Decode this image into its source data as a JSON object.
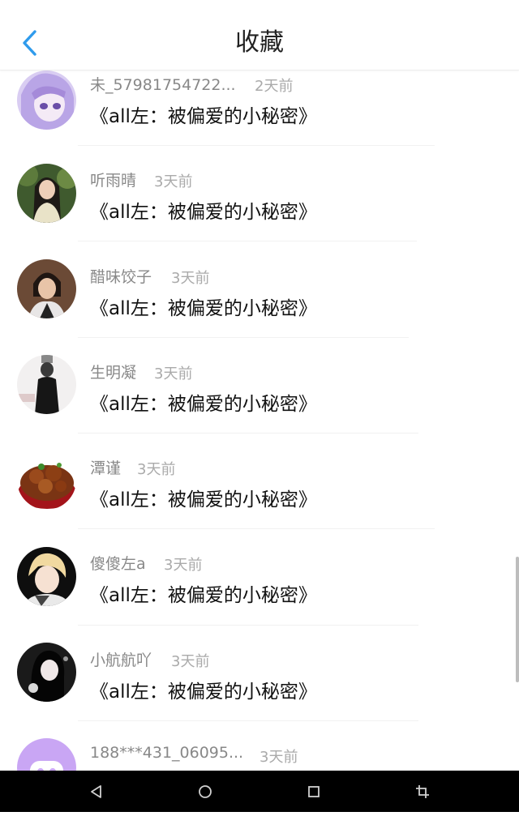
{
  "header": {
    "title": "收藏",
    "back_icon": "chevron-left-icon",
    "accent": "#2f9bec"
  },
  "items": [
    {
      "name": "未_57981754722...",
      "time": "2天前",
      "content": "《all左：被偏爱的小秘密》",
      "avatar": "lavender-anime-avatar"
    },
    {
      "name": "听雨晴",
      "time": "3天前",
      "content": "《all左：被偏爱的小秘密》",
      "avatar": "girl-outdoor-avatar"
    },
    {
      "name": "醋味饺子",
      "time": "3天前",
      "content": "《all左：被偏爱的小秘密》",
      "avatar": "person-portrait-avatar"
    },
    {
      "name": "生明凝",
      "time": "3天前",
      "content": "《all左：被偏爱的小秘密》",
      "avatar": "dark-figure-avatar"
    },
    {
      "name": "潭谨",
      "time": "3天前",
      "content": "《all左：被偏爱的小秘密》",
      "avatar": "food-plate-avatar"
    },
    {
      "name": "傻傻左a",
      "time": "3天前",
      "content": "《all左：被偏爱的小秘密》",
      "avatar": "blond-boy-avatar"
    },
    {
      "name": "小航航吖",
      "time": "3天前",
      "content": "《all左：被偏爱的小秘密》",
      "avatar": "dark-girl-avatar"
    },
    {
      "name": "188***431_06095...",
      "time": "3天前",
      "content": "",
      "avatar": "default-chat-avatar"
    }
  ],
  "navbar": {
    "icons": [
      "back-triangle-icon",
      "home-circle-icon",
      "recents-square-icon",
      "screenshot-crop-icon"
    ]
  }
}
